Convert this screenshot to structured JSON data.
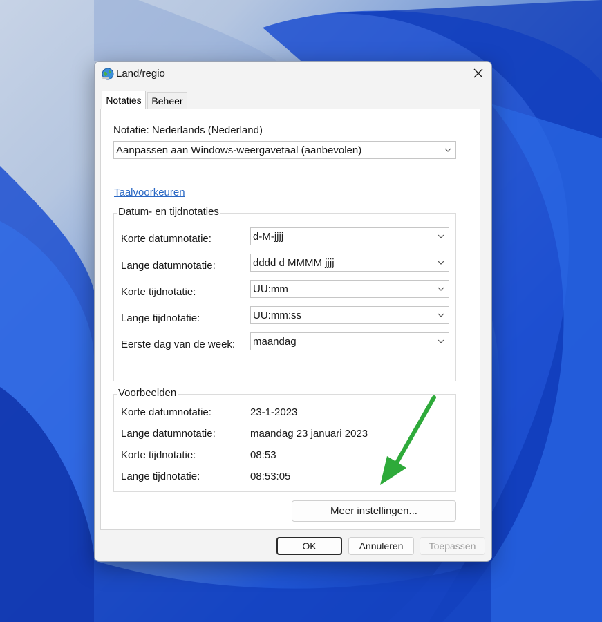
{
  "window": {
    "title": "Land/regio",
    "icon": "globe-icon"
  },
  "tabs": [
    {
      "label": "Notaties",
      "active": true
    },
    {
      "label": "Beheer",
      "active": false
    }
  ],
  "format": {
    "label": "Notatie: Nederlands (Nederland)",
    "selected": "Aanpassen aan Windows-weergavetaal (aanbevolen)"
  },
  "language_prefs_link": "Taalvoorkeuren",
  "date_time_formats": {
    "title": "Datum- en tijdnotaties",
    "rows": [
      {
        "label": "Korte datumnotatie:",
        "value": "d-M-jjjj"
      },
      {
        "label": "Lange datumnotatie:",
        "value": "dddd d MMMM jjjj"
      },
      {
        "label": "Korte tijdnotatie:",
        "value": "UU:mm"
      },
      {
        "label": "Lange tijdnotatie:",
        "value": "UU:mm:ss"
      },
      {
        "label": "Eerste dag van de week:",
        "value": "maandag"
      }
    ]
  },
  "examples": {
    "title": "Voorbeelden",
    "rows": [
      {
        "label": "Korte datumnotatie:",
        "value": "23-1-2023"
      },
      {
        "label": "Lange datumnotatie:",
        "value": "maandag 23 januari 2023"
      },
      {
        "label": "Korte tijdnotatie:",
        "value": "08:53"
      },
      {
        "label": "Lange tijdnotatie:",
        "value": "08:53:05"
      }
    ]
  },
  "buttons": {
    "more_settings": "Meer instellingen...",
    "ok": "OK",
    "cancel": "Annuleren",
    "apply": "Toepassen"
  },
  "colors": {
    "accent_arrow": "#2eaa3a",
    "link": "#2a68c4"
  }
}
